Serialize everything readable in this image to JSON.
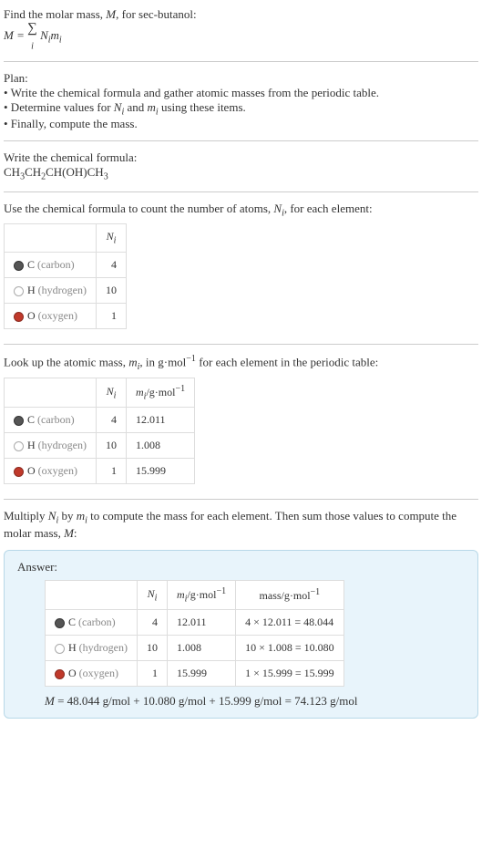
{
  "intro": {
    "line1_prefix": "Find the molar mass, ",
    "line1_var": "M",
    "line1_suffix": ", for sec-butanol:",
    "eq_lhs": "M",
    "eq_eq": " = ",
    "eq_sum": "∑",
    "eq_sub": "i",
    "eq_rhs_a": " N",
    "eq_rhs_b": "i",
    "eq_rhs_c": "m",
    "eq_rhs_d": "i"
  },
  "plan": {
    "title": "Plan:",
    "b1": "• Write the chemical formula and gather atomic masses from the periodic table.",
    "b2_a": "• Determine values for ",
    "b2_b": "N",
    "b2_c": "i",
    "b2_d": " and ",
    "b2_e": "m",
    "b2_f": "i",
    "b2_g": " using these items.",
    "b3": "• Finally, compute the mass."
  },
  "chem": {
    "title": "Write the chemical formula:",
    "part1": "CH",
    "s1": "3",
    "part2": "CH",
    "s2": "2",
    "part3": "CH(OH)CH",
    "s3": "3"
  },
  "count": {
    "line_a": "Use the chemical formula to count the number of atoms, ",
    "line_b": "N",
    "line_c": "i",
    "line_d": ", for each element:",
    "header_N": "N",
    "header_Ni": "i",
    "rows": [
      {
        "symbol": "C",
        "name": " (carbon)",
        "n": "4"
      },
      {
        "symbol": "H",
        "name": " (hydrogen)",
        "n": "10"
      },
      {
        "symbol": "O",
        "name": " (oxygen)",
        "n": "1"
      }
    ]
  },
  "mass": {
    "line_a": "Look up the atomic mass, ",
    "line_b": "m",
    "line_c": "i",
    "line_d": ", in g·mol",
    "line_e": "−1",
    "line_f": " for each element in the periodic table:",
    "header_N": "N",
    "header_Ni": "i",
    "header_m": "m",
    "header_mi": "i",
    "header_unit": "/g·mol",
    "header_exp": "−1",
    "rows": [
      {
        "symbol": "C",
        "name": " (carbon)",
        "n": "4",
        "m": "12.011"
      },
      {
        "symbol": "H",
        "name": " (hydrogen)",
        "n": "10",
        "m": "1.008"
      },
      {
        "symbol": "O",
        "name": " (oxygen)",
        "n": "1",
        "m": "15.999"
      }
    ]
  },
  "multiply": {
    "a": "Multiply ",
    "b": "N",
    "c": "i",
    "d": " by ",
    "e": "m",
    "f": "i",
    "g": " to compute the mass for each element. Then sum those values to compute the molar mass, ",
    "h": "M",
    "i": ":"
  },
  "answer": {
    "label": "Answer:",
    "header_N": "N",
    "header_Ni": "i",
    "header_m": "m",
    "header_mi": "i",
    "header_munit": "/g·mol",
    "header_mexp": "−1",
    "header_mass": "mass/g·mol",
    "header_massexp": "−1",
    "rows": [
      {
        "symbol": "C",
        "name": " (carbon)",
        "n": "4",
        "m": "12.011",
        "calc": "4 × 12.011 = 48.044"
      },
      {
        "symbol": "H",
        "name": " (hydrogen)",
        "n": "10",
        "m": "1.008",
        "calc": "10 × 1.008 = 10.080"
      },
      {
        "symbol": "O",
        "name": " (oxygen)",
        "n": "1",
        "m": "15.999",
        "calc": "1 × 15.999 = 15.999"
      }
    ],
    "final_a": "M",
    "final_b": " = 48.044 g/mol + 10.080 g/mol + 15.999 g/mol = 74.123 g/mol"
  }
}
